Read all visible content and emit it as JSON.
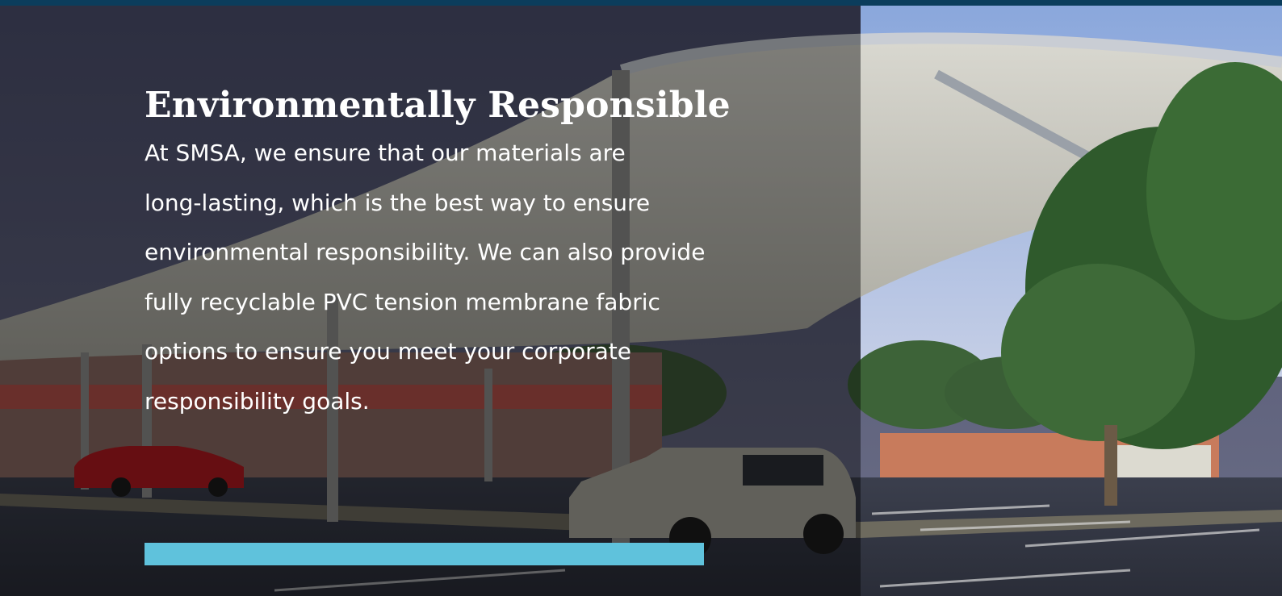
{
  "theme": {
    "top_bar_color": "#0b3d5c",
    "accent_color": "#5fc2dc",
    "sky_dusk": "#4a4d66",
    "sky_clear": "#9db5e2"
  },
  "hero": {
    "heading": "Environmentally Responsible",
    "paragraph_lines": [
      "At SMSA, we ensure that our materials are",
      "long-lasting, which is the best way to ensure",
      "environmental responsibility. We can also provide",
      "fully recyclable PVC tension membrane fabric",
      "options to ensure you meet your corporate",
      "responsibility goals."
    ],
    "progress": 1.0,
    "background_image": "car-park-shade-structure-photo"
  }
}
